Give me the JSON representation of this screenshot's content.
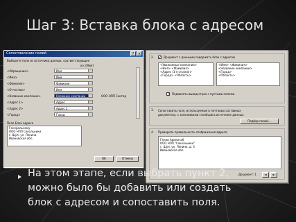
{
  "slide": {
    "title": "Шаг 3: Вставка блока с адресом",
    "body_lines": [
      "На этом этапе, если выбрать пункт 2,",
      "можно было бы добавить или создать",
      "блок с адресом и сопоставить поля."
    ]
  },
  "left_dialog": {
    "title": "Сопоставление полей",
    "intro_line": "Выберите поле из источника данных, соответствующее",
    "column_right": "из: [Имя]",
    "rows": [
      {
        "label": "<Обращение>",
        "value": "Имя",
        "selected": false
      },
      {
        "label": "<Имя>",
        "value": "Имя",
        "selected": false
      },
      {
        "label": "<Фамилия>",
        "value": "Фамилия",
        "selected": false
      },
      {
        "label": "<Отчество>",
        "value": "Имя",
        "selected": false
      },
      {
        "label": "<Название компании>",
        "value": "Название компании",
        "selected": true
      },
      {
        "label": "<Адрес 1>",
        "value": "Адрес",
        "selected": false
      },
      {
        "label": "<Адрес 2>",
        "value": "Адрес 2",
        "selected": false
      },
      {
        "label": "<Город>",
        "value": "Город",
        "selected": false
      }
    ],
    "selected_value_text": "ООО НПП Сектор",
    "preview_label": "Поле Блок адреса",
    "preview_lines": [
      "Генеральному",
      "ООО НПП Сокольники",
      "г. Шуя, ул. Ленина",
      "Ивановская обл."
    ],
    "ok_label": "ОК",
    "cancel_label": "Отмена"
  },
  "right_panel": {
    "sec2": {
      "num": "2.",
      "checkbox_label": "Документ с данными содержать блок с адресом",
      "checked": true,
      "list_left": [
        "<Уважаемые компании>",
        "<Имя> <Фамилия>",
        "<Адрес (1-я строка)>",
        "<Город> <Область>"
      ],
      "list_right": [
        "<Имя> <Фамилия>",
        "<Название компании>",
        "<Город>",
        "<Область>"
      ],
      "suppress_label": "Подавлять вывод строк с пустыми полями",
      "suppress_checked": true
    },
    "sec3": {
      "num": "3.",
      "text_line1": "Сопоставить поля, используемые в почтовых составных",
      "text_line2": "документах, с заголовками столбцов в источнике данных.",
      "button": "Подбор полей..."
    },
    "sec4": {
      "num": "4.",
      "label": "Проверить правильность отображения адреса:",
      "preview_lines": [
        "Гении Арипитаб",
        "ООО НПП \"Сокольники\"",
        "г. Шуя, ул. Ленина, д. 3",
        "Ивановская обл."
      ],
      "doc_label": "Документ: 1"
    }
  }
}
